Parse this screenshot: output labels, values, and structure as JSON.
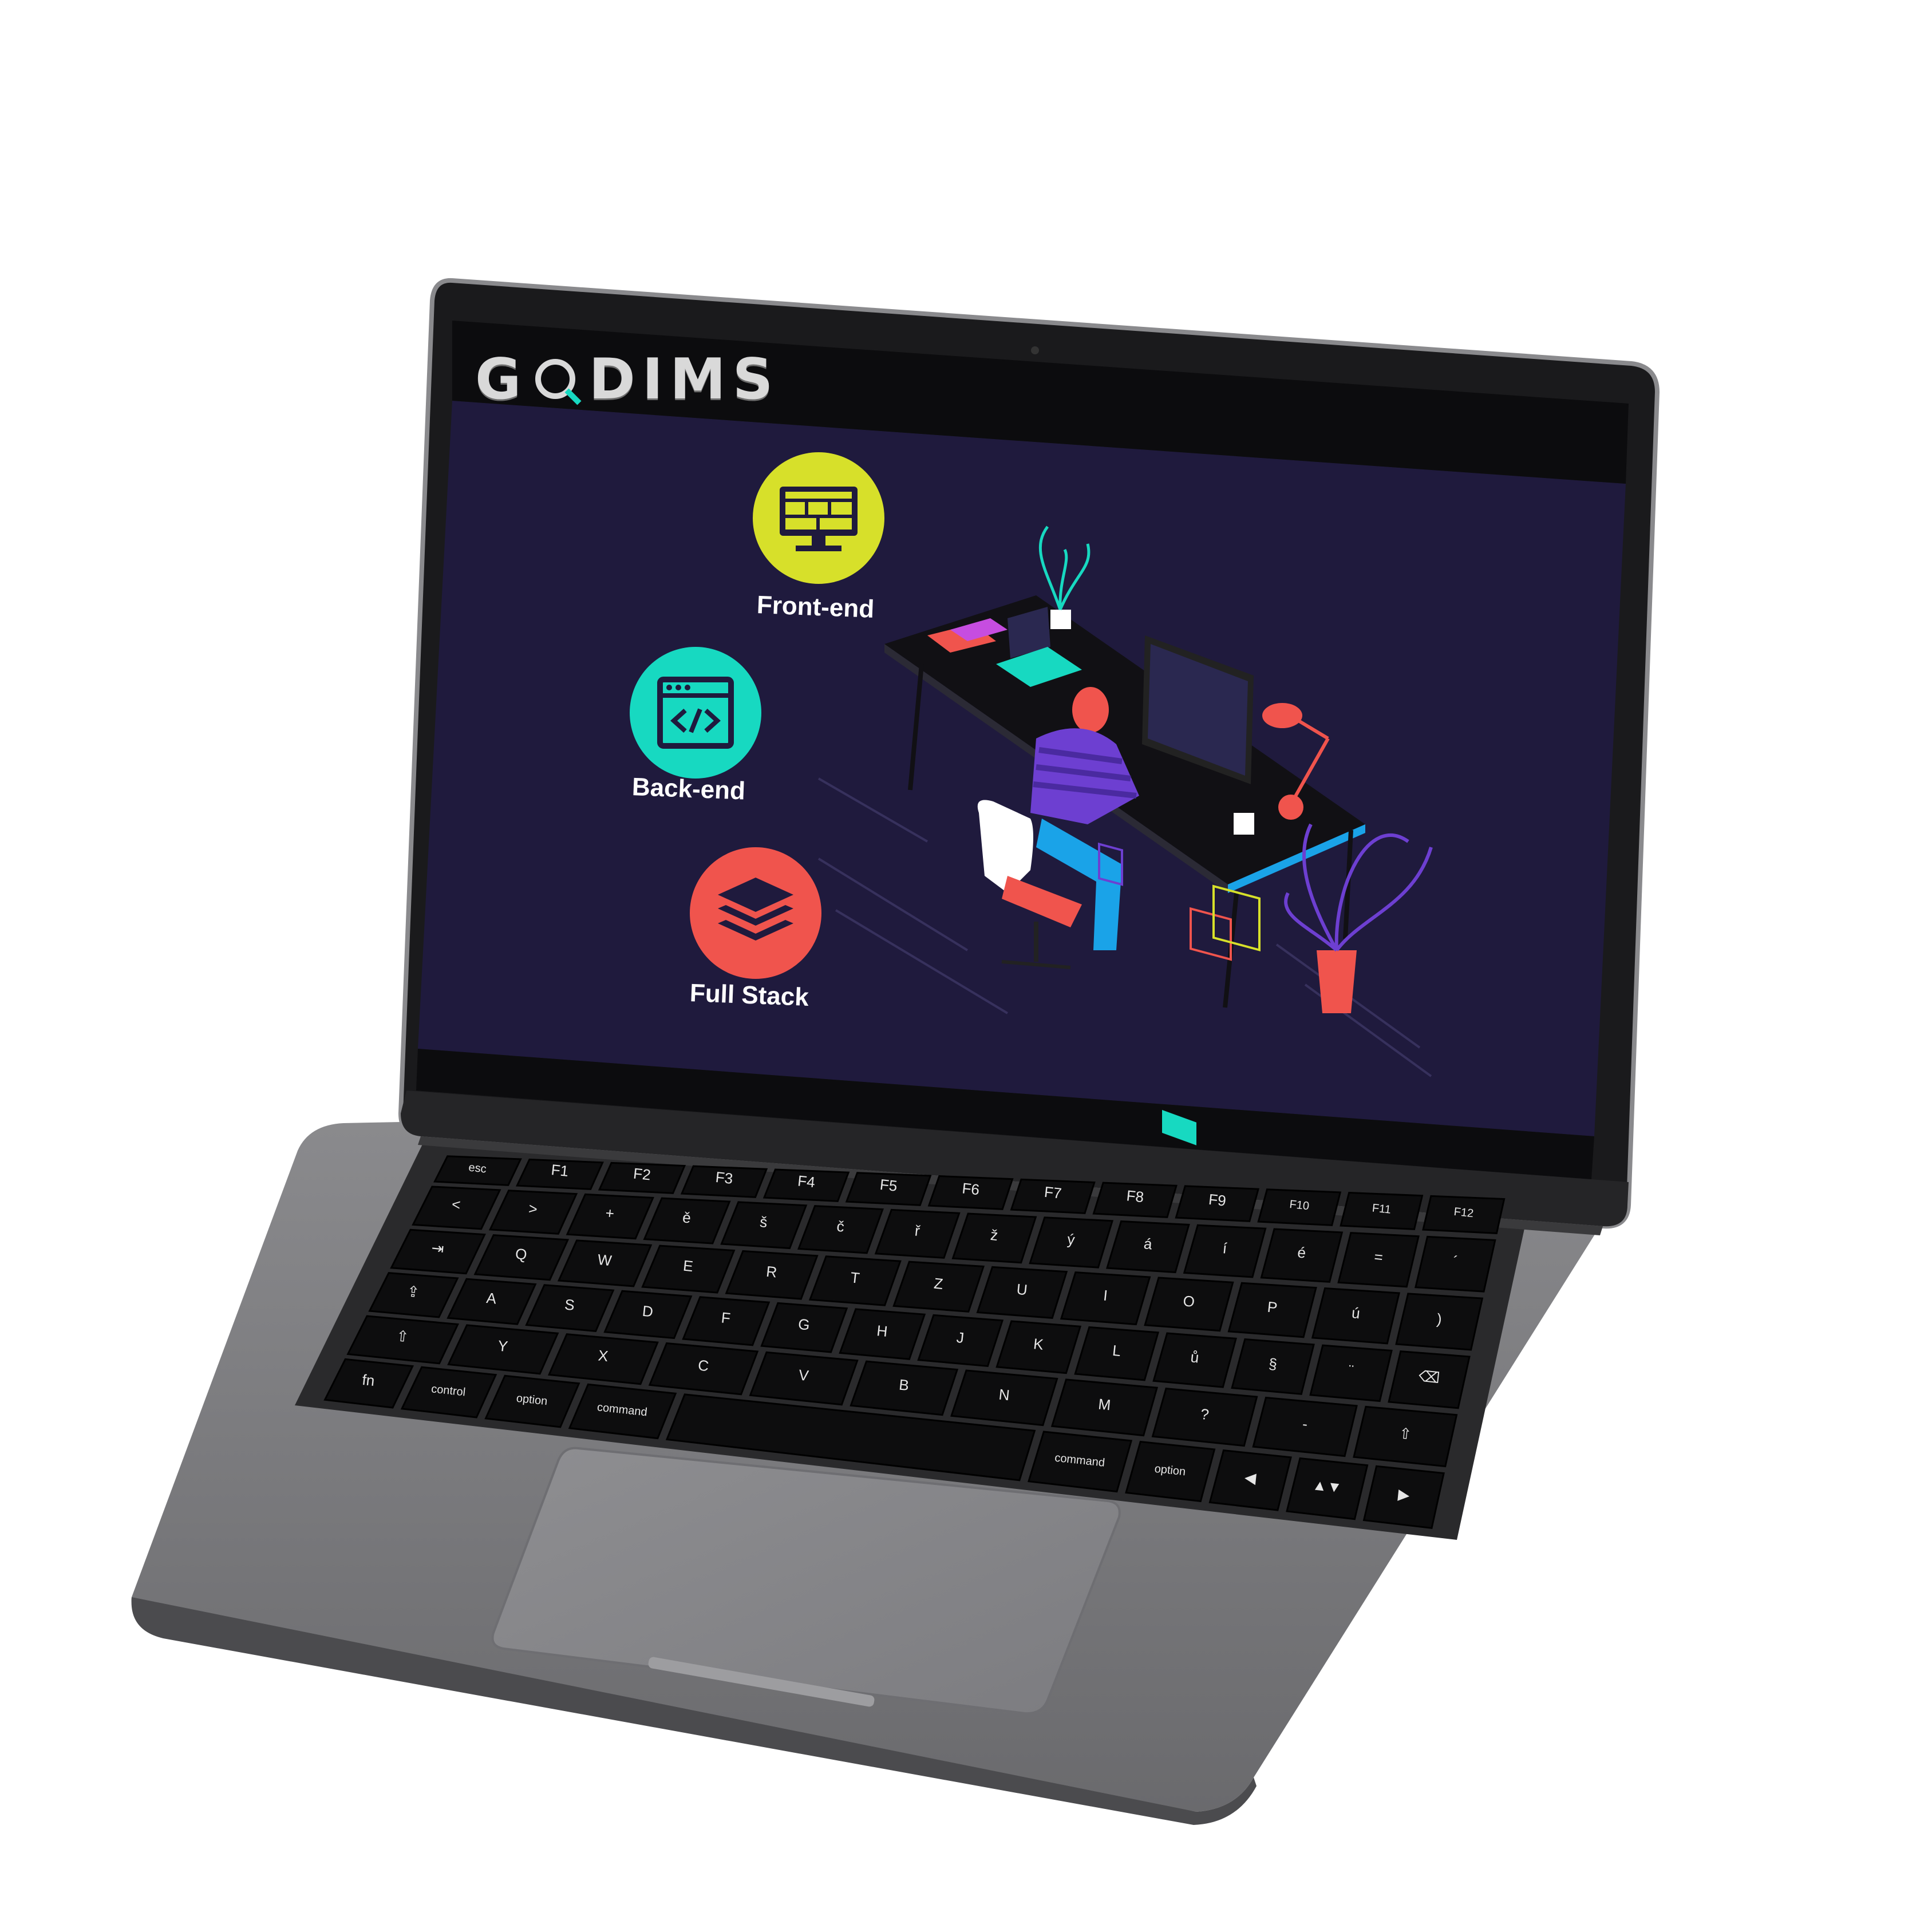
{
  "screen": {
    "logo_text": "GODIMS",
    "logo_letters": [
      "G",
      "DIMS"
    ],
    "features": [
      {
        "label": "Front-end",
        "icon": "monitor-icon",
        "color": "#d7e02a"
      },
      {
        "label": "Back-end",
        "icon": "code-window-icon",
        "color": "#17d9c1"
      },
      {
        "label": "Full Stack",
        "icon": "layers-icon",
        "color": "#f0544d"
      }
    ],
    "background_color": "#1f1a3d"
  },
  "keyboard": {
    "fn_row": [
      "esc",
      "F1",
      "F2",
      "F3",
      "F4",
      "F5",
      "F6",
      "F7",
      "F8",
      "F9",
      "F10",
      "F11",
      "F12"
    ],
    "row1": [
      "<",
      ">",
      "+",
      "ě",
      "š",
      "č",
      "ř",
      "ž",
      "ý",
      "á",
      "í",
      "é",
      "=",
      "´"
    ],
    "row2": [
      "Q",
      "W",
      "E",
      "R",
      "T",
      "Z",
      "U",
      "I",
      "O",
      "P",
      "ú",
      ")"
    ],
    "row3": [
      "A",
      "S",
      "D",
      "F",
      "G",
      "H",
      "J",
      "K",
      "L",
      "ů",
      "§",
      "¨"
    ],
    "row4": [
      "Y",
      "X",
      "C",
      "V",
      "B",
      "N",
      "M",
      "?",
      "-"
    ],
    "mods": {
      "fn": "fn",
      "control": "control",
      "option": "option",
      "command": "command",
      "command_r": "command",
      "option_r": "option"
    }
  }
}
